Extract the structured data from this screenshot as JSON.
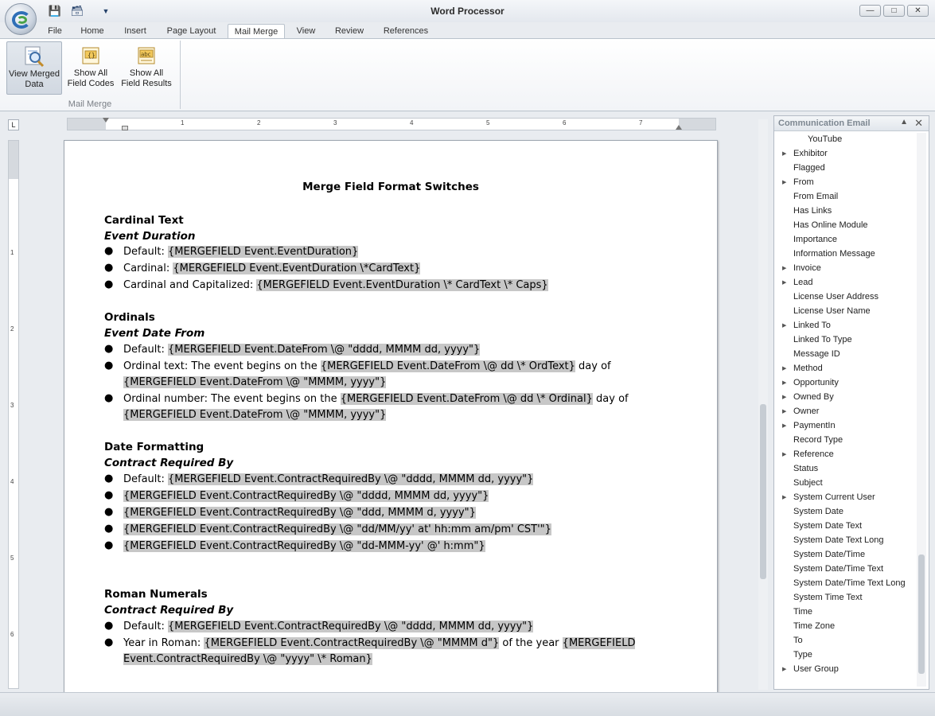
{
  "window": {
    "title": "Word Processor"
  },
  "tabs": [
    "File",
    "Home",
    "Insert",
    "Page Layout",
    "Mail Merge",
    "View",
    "Review",
    "References"
  ],
  "active_tab": "Mail Merge",
  "ribbon": {
    "buttons": [
      {
        "line1": "View Merged",
        "line2": "Data"
      },
      {
        "line1": "Show All",
        "line2": "Field Codes"
      },
      {
        "line1": "Show All",
        "line2": "Field Results"
      }
    ],
    "group_label": "Mail Merge"
  },
  "ruler": {
    "corner": "L",
    "h_numbers": [
      "1",
      "2",
      "3",
      "4",
      "5",
      "6",
      "7"
    ],
    "v_numbers": [
      "1",
      "2",
      "3",
      "4",
      "5",
      "6"
    ]
  },
  "document": {
    "title": "Merge Field Format Switches",
    "cardinal": {
      "heading": "Cardinal Text",
      "sub": "Event Duration",
      "b1_label": "Default: ",
      "b1_field": "{MERGEFIELD Event.EventDuration}",
      "b2_label": "Cardinal: ",
      "b2_field": "{MERGEFIELD Event.EventDuration \\*CardText}",
      "b3_label": "Cardinal and Capitalized: ",
      "b3_field": "{MERGEFIELD Event.EventDuration \\* CardText \\* Caps}"
    },
    "ordinals": {
      "heading": "Ordinals",
      "sub": "Event Date From",
      "b1_label": "Default: ",
      "b1_field": "{MERGEFIELD Event.DateFrom \\@ \"dddd, MMMM dd, yyyy\"}",
      "b2_label": "Ordinal text:  The event begins on the ",
      "b2_field": "{MERGEFIELD Event.DateFrom \\@ dd \\* OrdText}",
      "b2_after": " day of",
      "b2_cont": "{MERGEFIELD Event.DateFrom \\@ \"MMMM, yyyy\"}",
      "b3_label": "Ordinal number:  The event begins on the ",
      "b3_field": "{MERGEFIELD Event.DateFrom \\@ dd \\* Ordinal}",
      "b3_after": " day of",
      "b3_cont": "{MERGEFIELD Event.DateFrom \\@ \"MMMM, yyyy\"}"
    },
    "dates": {
      "heading": "Date Formatting",
      "sub": "Contract Required By",
      "b1_label": "Default: ",
      "b1_field": "{MERGEFIELD Event.ContractRequiredBy \\@ \"dddd, MMMM dd, yyyy\"}",
      "b2_field": "{MERGEFIELD Event.ContractRequiredBy \\@ \"dddd, MMMM dd, yyyy\"}",
      "b3_field": "{MERGEFIELD Event.ContractRequiredBy \\@ \"ddd, MMMM d, yyyy\"}",
      "b4_field": "{MERGEFIELD Event.ContractRequiredBy \\@ \"dd/MM/yy' at' hh:mm am/pm' CST'\"}",
      "b5_field": "{MERGEFIELD Event.ContractRequiredBy \\@ \"dd-MMM-yy' @' h:mm\"}"
    },
    "roman": {
      "heading": "Roman Numerals",
      "sub": "Contract Required By",
      "b1_label": "Default: ",
      "b1_field": "{MERGEFIELD Event.ContractRequiredBy \\@ \"dddd, MMMM dd, yyyy\"}",
      "b2_label": "Year in Roman: ",
      "b2_field": "{MERGEFIELD Event.ContractRequiredBy \\@ \"MMMM d\"}",
      "b2_after": " of the year ",
      "b2_field2a": "{MERGEFIELD",
      "b2_field2b": "Event.ContractRequiredBy \\@ \"yyyy\" \\* Roman}"
    }
  },
  "panel": {
    "title": "Communication Email",
    "items": [
      {
        "label": "YouTube",
        "expandable": false
      },
      {
        "label": "Exhibitor",
        "expandable": true
      },
      {
        "label": "Flagged",
        "expandable": false
      },
      {
        "label": "From",
        "expandable": true
      },
      {
        "label": "From Email",
        "expandable": false
      },
      {
        "label": "Has Links",
        "expandable": false
      },
      {
        "label": "Has Online Module",
        "expandable": false
      },
      {
        "label": "Importance",
        "expandable": false
      },
      {
        "label": "Information Message",
        "expandable": false
      },
      {
        "label": "Invoice",
        "expandable": true
      },
      {
        "label": "Lead",
        "expandable": true
      },
      {
        "label": "License User Address",
        "expandable": false
      },
      {
        "label": "License User Name",
        "expandable": false
      },
      {
        "label": "Linked To",
        "expandable": true
      },
      {
        "label": "Linked To Type",
        "expandable": false
      },
      {
        "label": "Message ID",
        "expandable": false
      },
      {
        "label": "Method",
        "expandable": true
      },
      {
        "label": "Opportunity",
        "expandable": true
      },
      {
        "label": "Owned By",
        "expandable": true
      },
      {
        "label": "Owner",
        "expandable": true
      },
      {
        "label": "PaymentIn",
        "expandable": true
      },
      {
        "label": "Record Type",
        "expandable": false
      },
      {
        "label": "Reference",
        "expandable": true
      },
      {
        "label": "Status",
        "expandable": false
      },
      {
        "label": "Subject",
        "expandable": false
      },
      {
        "label": "System Current User",
        "expandable": true
      },
      {
        "label": "System Date",
        "expandable": false
      },
      {
        "label": "System Date Text",
        "expandable": false
      },
      {
        "label": "System Date Text Long",
        "expandable": false
      },
      {
        "label": "System Date/Time",
        "expandable": false
      },
      {
        "label": "System Date/Time Text",
        "expandable": false
      },
      {
        "label": "System Date/Time Text Long",
        "expandable": false
      },
      {
        "label": "System Time Text",
        "expandable": false
      },
      {
        "label": "Time",
        "expandable": false
      },
      {
        "label": "Time Zone",
        "expandable": false
      },
      {
        "label": "To",
        "expandable": false
      },
      {
        "label": "Type",
        "expandable": false
      },
      {
        "label": "User Group",
        "expandable": true
      }
    ]
  }
}
